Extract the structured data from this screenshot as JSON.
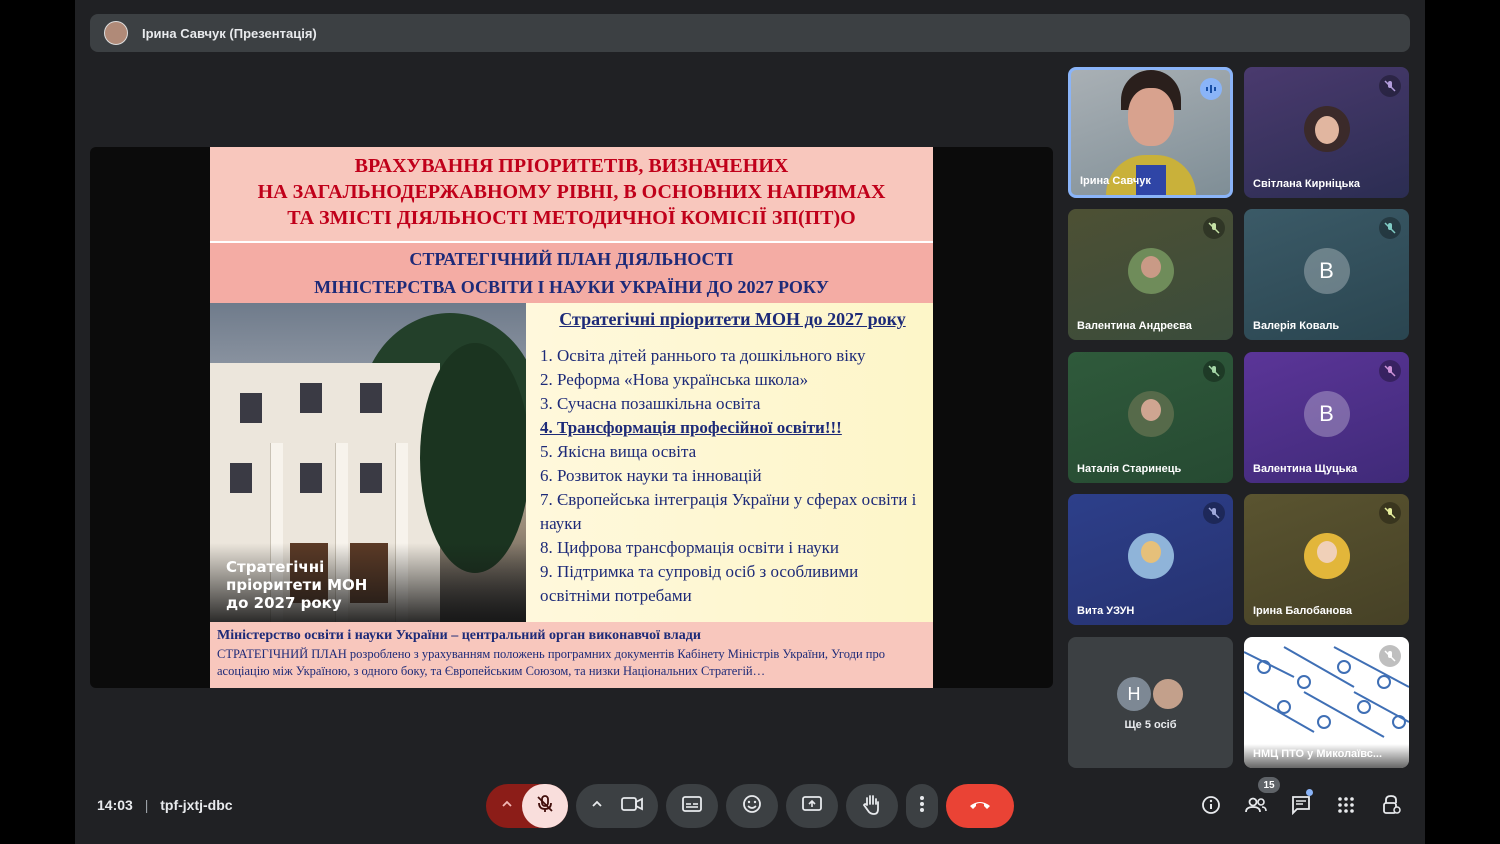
{
  "header": {
    "presenter_title": "Ірина Савчук (Презентація)"
  },
  "slide": {
    "heading": [
      "ВРАХУВАННЯ ПРІОРИТЕТІВ, ВИЗНАЧЕНИХ",
      "НА ЗАГАЛЬНОДЕРЖАВНОМУ РІВНІ, В ОСНОВНИХ НАПРЯМАХ",
      "ТА ЗМІСТІ ДІЯЛЬНОСТІ МЕТОДИЧНОЇ КОМІСІЇ ЗП(ПТ)О"
    ],
    "subheading": [
      "СТРАТЕГІЧНИЙ ПЛАН ДІЯЛЬНОСТІ",
      "МІНІСТЕРСТВА ОСВІТИ І НАУКИ УКРАЇНИ ДО 2027 РОКУ"
    ],
    "photo_caption": [
      "Стратегічні",
      "пріоритети МОН",
      "до 2027 року"
    ],
    "list_title": "Стратегічні пріоритети МОН до 2027 року",
    "items": [
      "1. Освіта дітей раннього та дошкільного віку",
      "2. Реформа «Нова українська школа»",
      "3. Сучасна позашкільна освіта",
      "4. Трансформація професійної освіти!!!",
      "5. Якісна вища освіта",
      "6. Розвиток науки та інновацій",
      "7. Європейська інтеграція України у сферах освіти і науки",
      "8. Цифрова трансформація освіти і науки",
      "9. Підтримка та супровід осіб з особливими освітніми потребами"
    ],
    "footer_bold": "Міністерство освіти і науки України – центральний орган виконавчої влади",
    "footer_text": "СТРАТЕГІЧНИЙ ПЛАН розроблено з урахуванням положень програмних документів Кабінету Міністрів України, Угоди про асоціацію між Україною, з одного боку, та Європейським Союзом, та низки Національних Стратегій…"
  },
  "participants": [
    {
      "name": "Ірина Савчук",
      "status": "speaking"
    },
    {
      "name": "Світлана Кирніцька",
      "status": "muted"
    },
    {
      "name": "Валентина Андреєва",
      "status": "muted"
    },
    {
      "name": "Валерія Коваль",
      "status": "muted",
      "initial": "В"
    },
    {
      "name": "Наталія Старинець",
      "status": "muted"
    },
    {
      "name": "Валентина Щуцька",
      "status": "muted",
      "initial": "В"
    },
    {
      "name": "Вита УЗУН",
      "status": "muted"
    },
    {
      "name": "Ірина Балобанова",
      "status": "muted"
    },
    {
      "name": "Ще 5 осіб",
      "initial": "Н"
    },
    {
      "name": "НМЦ ПТО у Миколаївс...",
      "status": "muted"
    }
  ],
  "footer": {
    "time": "14:03",
    "separator": "|",
    "meeting_code": "tpf-jxtj-dbc",
    "participant_count": "15"
  },
  "colors": {
    "end_call": "#ea4335",
    "mic_off_bg": "#f9dedc",
    "mic_bg": "#8c1d18",
    "accent": "#8ab4f8"
  }
}
